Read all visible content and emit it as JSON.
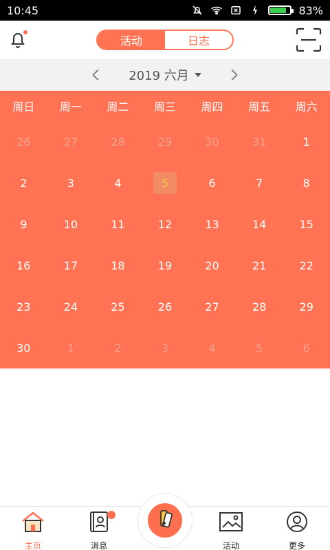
{
  "status_bar": {
    "time": "10:45",
    "battery": "83%",
    "battery_level": 0.83
  },
  "header": {
    "tabs": [
      {
        "label": "活动",
        "active": true
      },
      {
        "label": "日志",
        "active": false
      }
    ]
  },
  "month_nav": {
    "label": "2019 六月"
  },
  "calendar": {
    "weekdays": [
      "周日",
      "周一",
      "周二",
      "周三",
      "周四",
      "周五",
      "周六"
    ],
    "weeks": [
      [
        {
          "day": "26",
          "in_month": false
        },
        {
          "day": "27",
          "in_month": false
        },
        {
          "day": "28",
          "in_month": false
        },
        {
          "day": "29",
          "in_month": false
        },
        {
          "day": "30",
          "in_month": false
        },
        {
          "day": "31",
          "in_month": false
        },
        {
          "day": "1",
          "in_month": true
        }
      ],
      [
        {
          "day": "2",
          "in_month": true
        },
        {
          "day": "3",
          "in_month": true
        },
        {
          "day": "4",
          "in_month": true
        },
        {
          "day": "5",
          "in_month": true,
          "today": true
        },
        {
          "day": "6",
          "in_month": true
        },
        {
          "day": "7",
          "in_month": true
        },
        {
          "day": "8",
          "in_month": true
        }
      ],
      [
        {
          "day": "9",
          "in_month": true
        },
        {
          "day": "10",
          "in_month": true
        },
        {
          "day": "11",
          "in_month": true
        },
        {
          "day": "12",
          "in_month": true
        },
        {
          "day": "13",
          "in_month": true
        },
        {
          "day": "14",
          "in_month": true
        },
        {
          "day": "15",
          "in_month": true
        }
      ],
      [
        {
          "day": "16",
          "in_month": true
        },
        {
          "day": "17",
          "in_month": true
        },
        {
          "day": "18",
          "in_month": true
        },
        {
          "day": "19",
          "in_month": true
        },
        {
          "day": "20",
          "in_month": true
        },
        {
          "day": "21",
          "in_month": true
        },
        {
          "day": "22",
          "in_month": true
        }
      ],
      [
        {
          "day": "23",
          "in_month": true
        },
        {
          "day": "24",
          "in_month": true
        },
        {
          "day": "25",
          "in_month": true
        },
        {
          "day": "26",
          "in_month": true
        },
        {
          "day": "27",
          "in_month": true
        },
        {
          "day": "28",
          "in_month": true
        },
        {
          "day": "29",
          "in_month": true
        }
      ],
      [
        {
          "day": "30",
          "in_month": true
        },
        {
          "day": "1",
          "in_month": false
        },
        {
          "day": "2",
          "in_month": false
        },
        {
          "day": "3",
          "in_month": false
        },
        {
          "day": "4",
          "in_month": false
        },
        {
          "day": "5",
          "in_month": false
        },
        {
          "day": "6",
          "in_month": false
        }
      ]
    ]
  },
  "bottom_nav": {
    "home": {
      "label": "主页",
      "icon": "house-icon",
      "active": true
    },
    "messages": {
      "label": "消息",
      "icon": "contacts-book-icon",
      "badge": true
    },
    "center": {
      "icon": "color-swatch-icon"
    },
    "activities": {
      "label": "活动",
      "icon": "picture-frame-icon"
    },
    "more": {
      "label": "更多",
      "icon": "user-circle-icon"
    }
  },
  "colors": {
    "accent": "#ff7352",
    "calendar_bg": "#ff7354",
    "today_text": "#f7c84a"
  }
}
